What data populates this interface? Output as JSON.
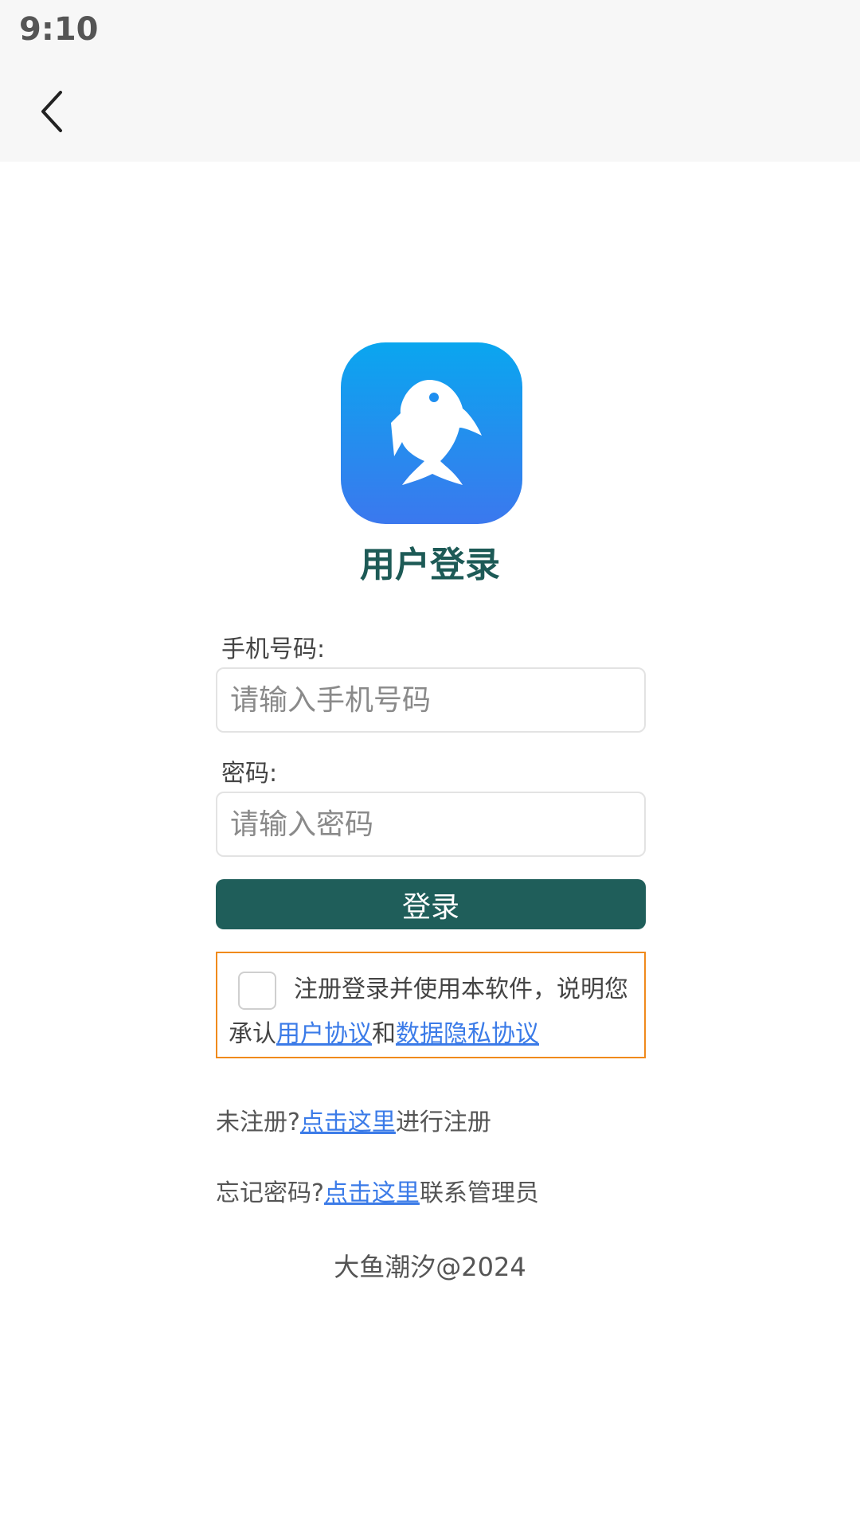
{
  "status_bar": {
    "time": "9:10"
  },
  "header": {
    "back_icon": "chevron-left-icon"
  },
  "logo": {
    "icon": "fish-icon",
    "colors": [
      "#0aa6ef",
      "#3b78ee"
    ]
  },
  "title": "用户登录",
  "form": {
    "phone_label": "手机号码:",
    "phone_placeholder": "请输入手机号码",
    "password_label": "密码:",
    "password_placeholder": "请输入密码",
    "login_button": "登录"
  },
  "agreement": {
    "checked": false,
    "text_prefix": "注册登录并使用本软件，说明您承认",
    "user_agreement": "用户协议",
    "connector": "和",
    "privacy_agreement": "数据隐私协议"
  },
  "register": {
    "prefix": "未注册?",
    "link": "点击这里",
    "suffix": "进行注册"
  },
  "forgot": {
    "prefix": "忘记密码?",
    "link": "点击这里",
    "suffix": "联系管理员"
  },
  "footer": "大鱼潮汐@2024",
  "colors": {
    "primary": "#1f5e5a",
    "link": "#3b7be8",
    "agreement_border": "#f08a1c"
  }
}
